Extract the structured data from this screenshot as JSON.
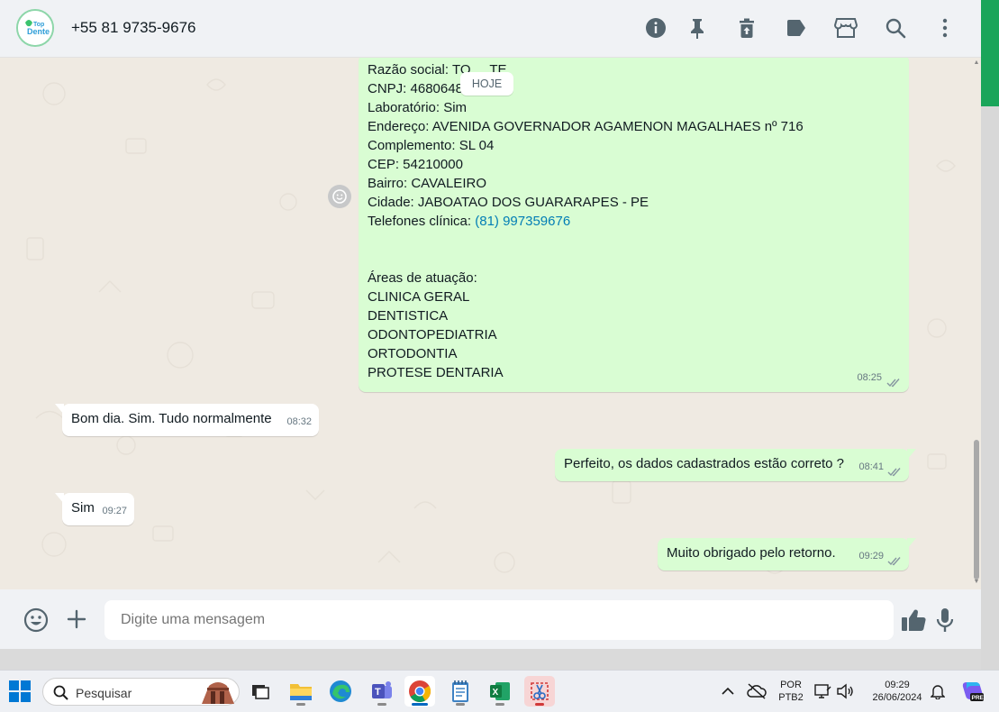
{
  "header": {
    "contact_name": "+55 81 9735-9676",
    "avatar_text": "Top Dente"
  },
  "chat": {
    "date_pill": "HOJE",
    "forwarded_message": {
      "lines": [
        "Razão social: TO",
        "CNPJ: 468064",
        "Laboratório: Sim",
        "Endereço: AVENIDA GOVERNADOR AGAMENON MAGALHAES nº 716",
        "Complemento: SL 04",
        "CEP: 54210000",
        "Bairro: CAVALEIRO",
        "Cidade: JABOATAO DOS GUARARAPES - PE"
      ],
      "razao_tail": "TE",
      "cnpj_tail": "8",
      "phone_label": "Telefones clínica: ",
      "phone_link": "(81) 997359676",
      "areas_title": "Áreas de atuação:",
      "areas": [
        "CLINICA GERAL",
        "DENTISTICA",
        "ODONTOPEDIATRIA",
        "ORTODONTIA",
        "PROTESE DENTARIA"
      ],
      "time": "08:25"
    },
    "messages": [
      {
        "direction": "in",
        "text": "Bom dia. Sim. Tudo normalmente",
        "time": "08:32"
      },
      {
        "direction": "out",
        "text": "Perfeito, os dados cadastrados estão correto ?",
        "time": "08:41"
      },
      {
        "direction": "in",
        "text": "Sim",
        "time": "09:27"
      },
      {
        "direction": "out",
        "text": "Muito obrigado pelo retorno.",
        "time": "09:29"
      }
    ]
  },
  "compose": {
    "placeholder": "Digite uma mensagem"
  },
  "taskbar": {
    "search_label": "Pesquisar",
    "language_line1": "POR",
    "language_line2": "PTB2",
    "time": "09:29",
    "date": "26/06/2024",
    "copilot_badge": "PRE"
  },
  "colors": {
    "outgoing_bubble": "#d9fdd3",
    "incoming_bubble": "#ffffff",
    "chat_background": "#efeae2",
    "link": "#027eb5",
    "accent_green": "#1aa55a"
  },
  "icons": {
    "header": [
      "info-icon",
      "pin-icon",
      "delete-icon",
      "label-icon",
      "store-icon",
      "search-icon",
      "menu-icon"
    ],
    "compose": [
      "emoji-icon",
      "plus-icon",
      "thumbs-up-icon",
      "microphone-icon"
    ]
  }
}
